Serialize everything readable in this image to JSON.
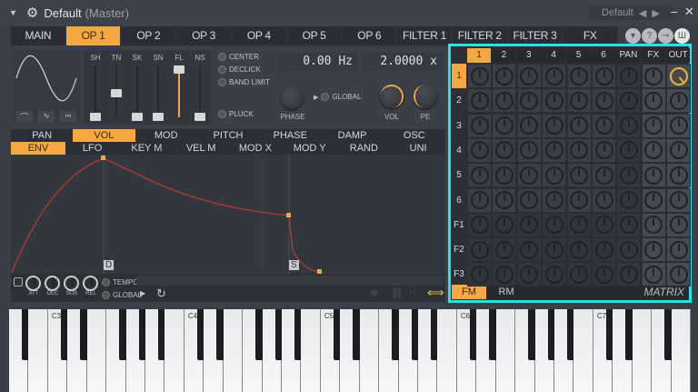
{
  "titlebar": {
    "title": "Default",
    "subtitle": "(Master)",
    "preset": "Default"
  },
  "tabs": [
    "MAIN",
    "OP 1",
    "OP 2",
    "OP 3",
    "OP 4",
    "OP 5",
    "OP 6",
    "FILTER 1",
    "FILTER 2",
    "FILTER 3",
    "FX"
  ],
  "active_tab": "OP 1",
  "operator": {
    "sliders": [
      {
        "label": "SH",
        "value": 0
      },
      {
        "label": "TN",
        "value": 0.5
      },
      {
        "label": "SK",
        "value": 0
      },
      {
        "label": "SN",
        "value": 0
      },
      {
        "label": "FL",
        "value": 1
      },
      {
        "label": "NS",
        "value": 0
      }
    ],
    "options": [
      "CENTER",
      "DECLICK",
      "BAND LIMIT",
      "PLUCK"
    ],
    "frequency": "0.00 Hz",
    "ratio": "2.0000 x",
    "phase_label": "PHASE",
    "global_label": "GLOBAL",
    "vol_label": "VOL",
    "pe_label": "PE"
  },
  "subtabs1": [
    "PAN",
    "VOL",
    "MOD",
    "PITCH",
    "PHASE",
    "DAMP",
    "OSC"
  ],
  "subtabs2": [
    "ENV",
    "LFO",
    "KEY M",
    "VEL M",
    "MOD X",
    "MOD Y",
    "RAND",
    "UNI"
  ],
  "envelope": {
    "decay_marker": "D",
    "sustain_marker": "S",
    "knobs": [
      "ATT",
      "DEC",
      "SUS",
      "REL"
    ],
    "tempo_label": "TEMPO",
    "global_label": "GLOBAL"
  },
  "matrix": {
    "columns": [
      "1",
      "2",
      "3",
      "4",
      "5",
      "6",
      "PAN",
      "FX",
      "OUT"
    ],
    "rows": [
      "1",
      "2",
      "3",
      "4",
      "5",
      "6",
      "F1",
      "F2",
      "F3"
    ],
    "footer_tabs": [
      "FM",
      "RM"
    ],
    "title": "MATRIX",
    "highlight_color": "#29e2e6"
  },
  "keyboard": {
    "labels": [
      "C3",
      "C4",
      "C5",
      "C6",
      "C7"
    ]
  },
  "colors": {
    "accent": "#f5a741",
    "envelope": "#c0392b"
  }
}
